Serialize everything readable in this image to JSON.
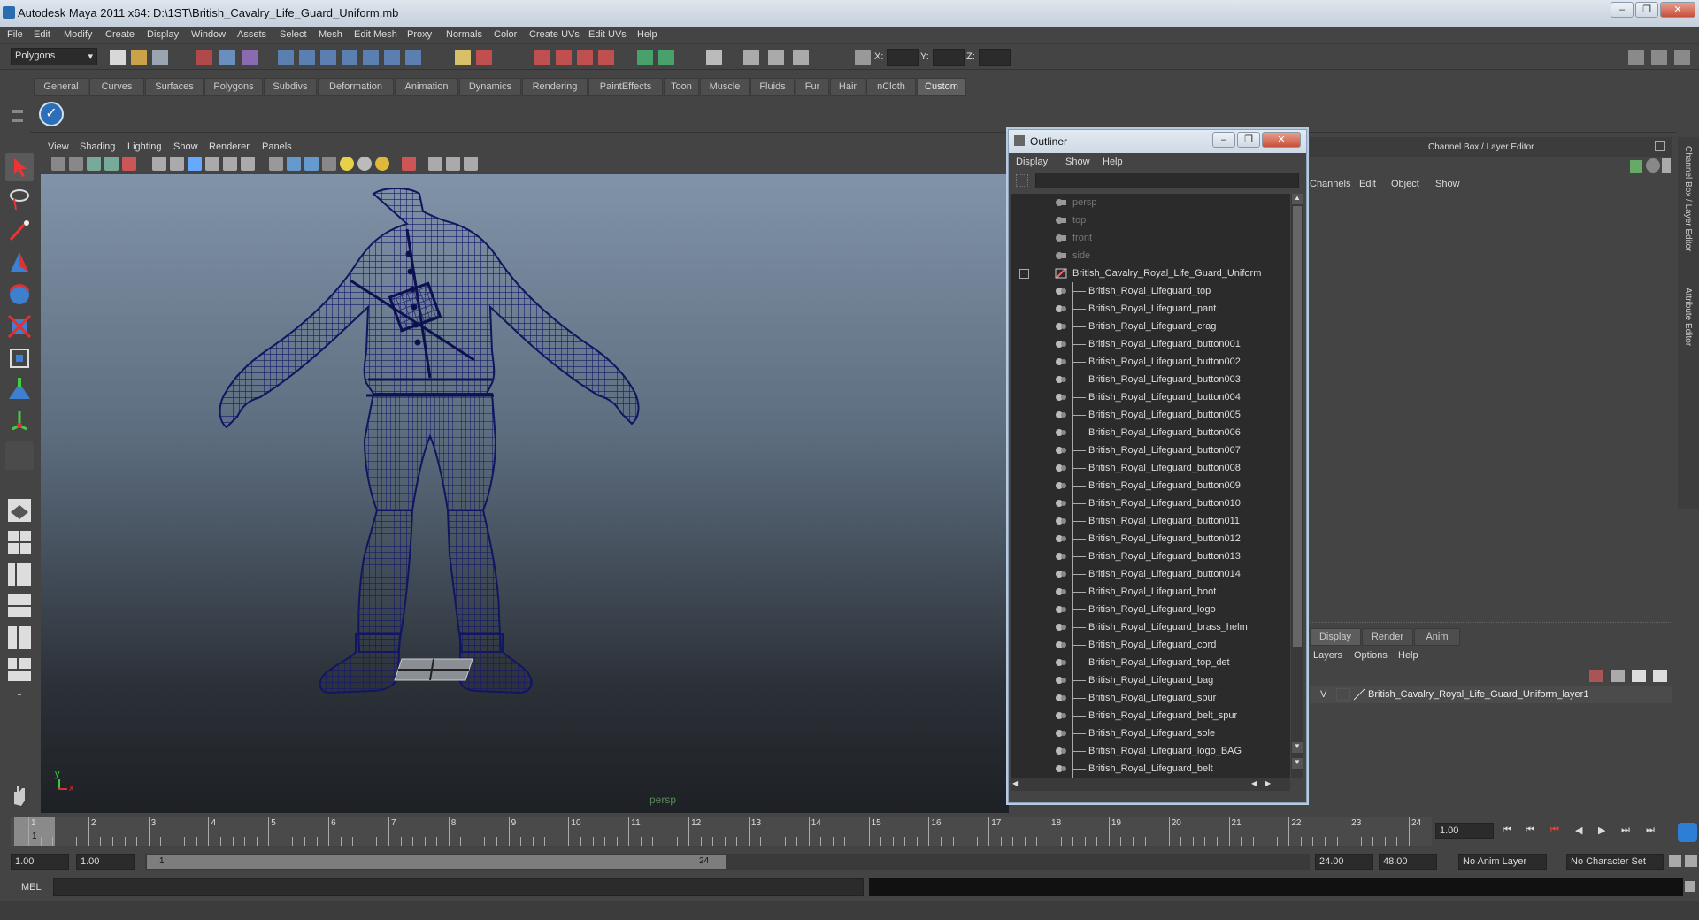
{
  "title": "Autodesk Maya 2011 x64: D:\\1ST\\British_Cavalry_Life_Guard_Uniform.mb",
  "window_controls": {
    "minimize": "–",
    "restore": "❐",
    "close": "✕"
  },
  "menus": [
    "File",
    "Edit",
    "Modify",
    "Create",
    "Display",
    "Window",
    "Assets",
    "Select",
    "Mesh",
    "Edit Mesh",
    "Proxy",
    "Normals",
    "Color",
    "Create UVs",
    "Edit UVs",
    "Help"
  ],
  "mode_selector": "Polygons",
  "coord_labels": {
    "x": "X:",
    "y": "Y:",
    "z": "Z:"
  },
  "shelf_tabs": [
    "General",
    "Curves",
    "Surfaces",
    "Polygons",
    "Subdivs",
    "Deformation",
    "Animation",
    "Dynamics",
    "Rendering",
    "PaintEffects",
    "Toon",
    "Muscle",
    "Fluids",
    "Fur",
    "Hair",
    "nCloth",
    "Custom"
  ],
  "active_shelf": "Custom",
  "viewport": {
    "menus": [
      "View",
      "Shading",
      "Lighting",
      "Show",
      "Renderer",
      "Panels"
    ],
    "camera_label": "persp",
    "axis": {
      "y": "y",
      "x": "x"
    }
  },
  "outliner": {
    "title": "Outliner",
    "menus": [
      "Display",
      "Show",
      "Help"
    ],
    "cameras": [
      "persp",
      "top",
      "front",
      "side"
    ],
    "root": "British_Cavalry_Royal_Life_Guard_Uniform",
    "expander": "−",
    "children": [
      "British_Royal_Lifeguard_top",
      "British_Royal_Lifeguard_pant",
      "British_Royal_Lifeguard_crag",
      "British_Royal_Lifeguard_button001",
      "British_Royal_Lifeguard_button002",
      "British_Royal_Lifeguard_button003",
      "British_Royal_Lifeguard_button004",
      "British_Royal_Lifeguard_button005",
      "British_Royal_Lifeguard_button006",
      "British_Royal_Lifeguard_button007",
      "British_Royal_Lifeguard_button008",
      "British_Royal_Lifeguard_button009",
      "British_Royal_Lifeguard_button010",
      "British_Royal_Lifeguard_button011",
      "British_Royal_Lifeguard_button012",
      "British_Royal_Lifeguard_button013",
      "British_Royal_Lifeguard_button014",
      "British_Royal_Lifeguard_boot",
      "British_Royal_Lifeguard_logo",
      "British_Royal_Lifeguard_brass_helm",
      "British_Royal_Lifeguard_cord",
      "British_Royal_Lifeguard_top_det",
      "British_Royal_Lifeguard_bag",
      "British_Royal_Lifeguard_spur",
      "British_Royal_Lifeguard_belt_spur",
      "British_Royal_Lifeguard_sole",
      "British_Royal_Lifeguard_logo_BAG",
      "British_Royal_Lifeguard_belt"
    ]
  },
  "channel_box": {
    "header": "Channel Box / Layer Editor",
    "menus": [
      "Channels",
      "Edit",
      "Object",
      "Show"
    ],
    "layer_tabs": [
      "Display",
      "Render",
      "Anim"
    ],
    "active_layer_tab": "Display",
    "layer_menus": [
      "Layers",
      "Options",
      "Help"
    ],
    "layer": {
      "visible": "V",
      "name": "British_Cavalry_Royal_Life_Guard_Uniform_layer1"
    }
  },
  "side_tabs": [
    "Channel Box / Layer Editor",
    "Attribute Editor"
  ],
  "timeline": {
    "ticks": [
      "1",
      "2",
      "3",
      "4",
      "5",
      "6",
      "7",
      "8",
      "9",
      "10",
      "11",
      "12",
      "13",
      "14",
      "15",
      "16",
      "17",
      "18",
      "19",
      "20",
      "21",
      "22",
      "23",
      "24"
    ],
    "current_frame": "1",
    "current_time_field": "1.00"
  },
  "range": {
    "start": "1.00",
    "playback_start": "1.00",
    "slider_start": "1",
    "slider_end": "24",
    "playback_end": "24.00",
    "end": "48.00",
    "anim_layer": "No Anim Layer",
    "character_set": "No Character Set"
  },
  "cmd_label": "MEL"
}
